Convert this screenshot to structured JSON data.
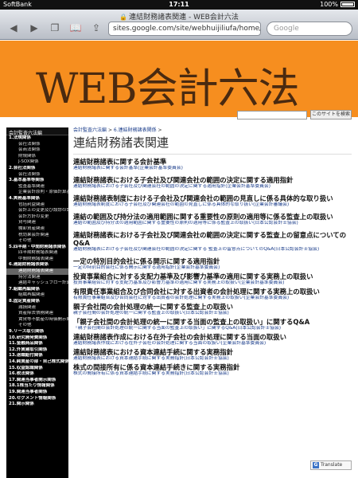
{
  "status": {
    "carrier": "SoftBank",
    "time": "17:11",
    "battery": "100%"
  },
  "browser": {
    "title": "連結財務諸表関連 - WEB会計六法",
    "url": "sites.google.com/site/webhuijiliufa/home/li...",
    "search_placeholder": "Google"
  },
  "site": {
    "logo": "WEB会計六法",
    "search_button": "このサイトを検索"
  },
  "sidebar": {
    "title": "会計監査六法編",
    "items": [
      {
        "label": "1.法規関係",
        "level": 0
      },
      {
        "label": "会社法関係",
        "level": 1
      },
      {
        "label": "会商法関係",
        "level": 1
      },
      {
        "label": "財規関係",
        "level": 1
      },
      {
        "label": "J-SOX関係",
        "level": 1
      },
      {
        "label": "2.会社法関係",
        "level": 0
      },
      {
        "label": "会社法関係",
        "level": 1
      },
      {
        "label": "3.基本基準等関係",
        "level": 0
      },
      {
        "label": "監査基準関連",
        "level": 1
      },
      {
        "label": "企業会計原則・原価計算基準",
        "level": 1
      },
      {
        "label": "4.実務基準関係",
        "level": 0
      },
      {
        "label": "包括利益関連",
        "level": 1
      },
      {
        "label": "会計上の変更及び誤謬の訂正関連",
        "level": 1
      },
      {
        "label": "会計方針の変更",
        "level": 1
      },
      {
        "label": "貸与関連",
        "level": 1
      },
      {
        "label": "棚卸資産関連",
        "level": 1
      },
      {
        "label": "税効果会計関連",
        "level": 1
      },
      {
        "label": "その他",
        "level": 1
      },
      {
        "label": "5.四半期・中間財務諸表関係",
        "level": 0
      },
      {
        "label": "四半期財務諸表関連",
        "level": 1
      },
      {
        "label": "中間財務諸表関連",
        "level": 1
      },
      {
        "label": "6.連結財務諸表関係",
        "level": 0
      },
      {
        "label": "連結財務諸表関連",
        "level": 1,
        "active": true
      },
      {
        "label": "持分法関連",
        "level": 1
      },
      {
        "label": "連結キャッシュフロー計算書関連",
        "level": 1
      },
      {
        "label": "7.組織再編関係",
        "level": 0
      },
      {
        "label": "組織再編関連",
        "level": 1
      },
      {
        "label": "8.固定資産関係",
        "level": 0
      },
      {
        "label": "減損関連",
        "level": 1
      },
      {
        "label": "資産除去債務関連",
        "level": 1
      },
      {
        "label": "賃貸等不動産の時価開示関連",
        "level": 1
      },
      {
        "label": "その他",
        "level": 1
      },
      {
        "label": "9.リース取引関係",
        "level": 0
      },
      {
        "label": "10.研究開発費関係",
        "level": 0
      },
      {
        "label": "11.金融商品関係",
        "level": 0
      },
      {
        "label": "12.外貨建取引関係",
        "level": 0
      },
      {
        "label": "13.退職給付関係",
        "level": 0
      },
      {
        "label": "14.純資産の部・自己株式関係",
        "level": 0
      },
      {
        "label": "15.収益認識関係",
        "level": 0
      },
      {
        "label": "16.税法関係",
        "level": 0
      },
      {
        "label": "17.関連当事者開示関係",
        "level": 0
      },
      {
        "label": "18.1株当たり情報関係",
        "level": 0
      },
      {
        "label": "19.関連当事者関係",
        "level": 0
      },
      {
        "label": "20.セグメント情報関係",
        "level": 0
      },
      {
        "label": "21.関示関係",
        "level": 0
      }
    ]
  },
  "main": {
    "breadcrumb": [
      "会計監査六法編",
      "6.連結財務諸表関係"
    ],
    "breadcrumb_sep": ">",
    "title": "連結財務諸表関連",
    "entries": [
      {
        "heading": "連結財務諸表に関する会計基準",
        "sub": "連結財務諸表に関する会計基準(企業会計基準委員会)"
      },
      {
        "heading": "連結財務諸表における子会社及び関連会社の範囲の決定に関する適用指針",
        "sub": "連結財務諸表における子会社及び関連会社の範囲の決定に関する適用指針(企業会計基準委員会)"
      },
      {
        "heading": "連結財務諸表制度における子会社及び関連会社の範囲の見直しに係る具体的な取り扱い",
        "sub": "連結財務諸表制度における子会社及び関連会社の範囲の見直しに係る具体的な取り扱い(企業会計審議会)"
      },
      {
        "heading": "連結の範囲及び持分法の適用範囲に関する重要性の原則の適用等に係る監査上の取扱い",
        "sub": "連結の範囲及び持分法の適用範囲に関する重要性の原則の適用等に係る監査上の取扱い(日本公認会計士協会)"
      },
      {
        "heading": "連結財務諸表における子会社及び関連会社の範囲の決定に関する監査上の留意点についてのQ&A",
        "sub": "連結財務諸表における子会社及び関連会社の範囲の決定に関する 監査上の留意点についてのQ&A(日本公認会計士協会)"
      },
      {
        "heading": "一定の特別目的会社に係る開示に関する適用指針",
        "sub": "一定の特別目的会社に係る開示に関する適用指針(企業会計基準委員会)"
      },
      {
        "heading": "投資事業組合に対する支配力基準及び影響力基準の適用に関する実務上の取扱い",
        "sub": "投資事業組合に対する支配力基準及び影響力基準の適用に関する実務上の取扱い(企業会計基準委員会)"
      },
      {
        "heading": "有限責任事業組合及び合同会社に対する出資者の会計処理に関する実務上の取扱い",
        "sub": "有限責任事業組合及び合同会社に対する出資者の会計処理に関する実務上の取扱い(企業会計基準委員会)"
      },
      {
        "heading": "親子会社間の会計処理の統一に関する監査上の取扱い",
        "sub": "親子会社間の会計処理の統一に関する監査上の取扱い(日本公認会計士協会)"
      },
      {
        "heading": "「親子会社間の会計処理の統一に関する当面の監査上の取扱い」に関するQ&A",
        "sub": "「親子会社間の会計処理の統一に関する当面の監査上の取扱い」に関するQ&A(日本公認会計士協会)"
      },
      {
        "heading": "連結財務諸表作成における在外子会社の会計処理に関する当面の取扱い",
        "sub": "連結財務諸表作成における在外子会社の会計処理に関する当面の取扱い(企業会計基準委員会)"
      },
      {
        "heading": "連結財務諸表における資本連結手続に関する実務指針",
        "sub": "連結財務諸表における資本連結手続に関する実務指針(日本公認会計士協会)"
      },
      {
        "heading": "株式の間接所有に係る資本連結手続きに関する実務指針",
        "sub": "株式の間接所有に係る資本連結手続に関する実務指針(日本公認会計士協会)"
      }
    ]
  },
  "translate": {
    "label": "Translate",
    "icon": "G"
  }
}
